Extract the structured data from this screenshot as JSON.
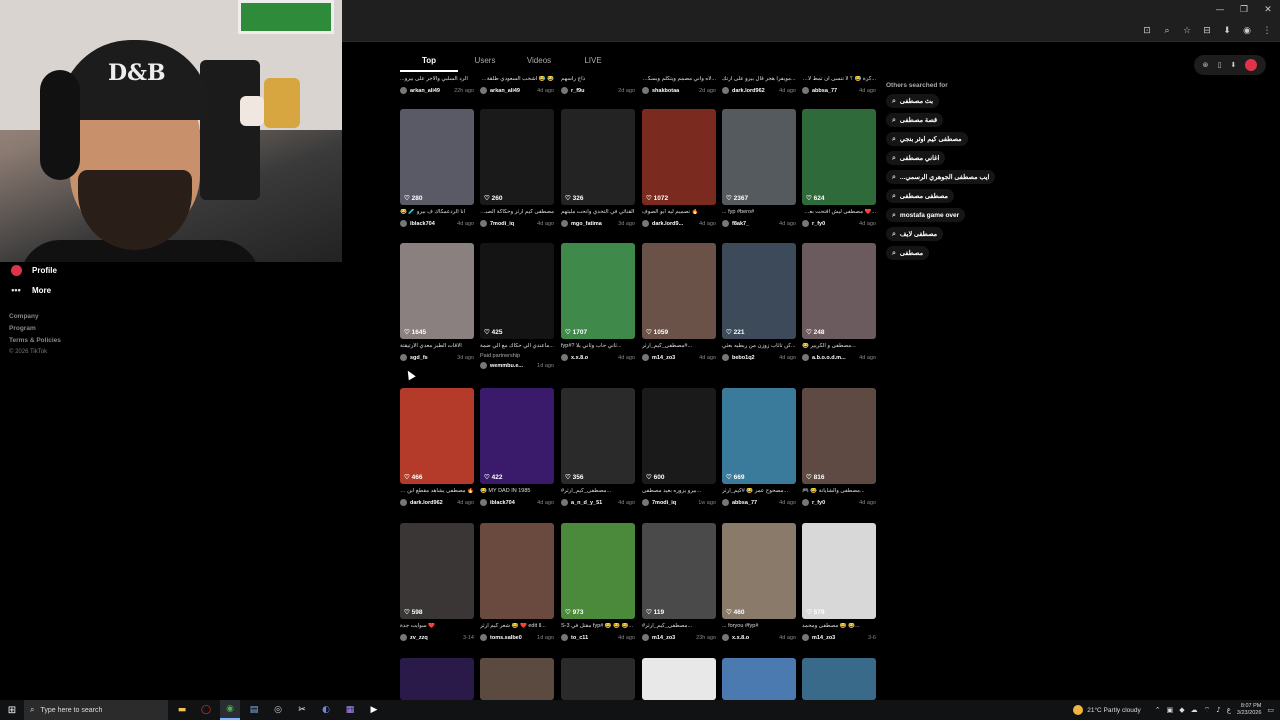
{
  "browser": {
    "window_controls": [
      "—",
      "❐",
      "✕"
    ],
    "address_icons": [
      "⊡",
      "⌕",
      "☆",
      "⊟",
      "⬇",
      "◉",
      "⋮"
    ]
  },
  "sidebar": {
    "items": [
      {
        "label": "Profile",
        "icon": "profile-icon"
      },
      {
        "label": "More",
        "icon": "more-icon"
      }
    ],
    "footer": {
      "company": "Company",
      "program": "Program",
      "terms": "Terms & Policies",
      "copyright": "© 2026 TikTok"
    }
  },
  "tabs": [
    {
      "label": "Top",
      "active": true
    },
    {
      "label": "Users",
      "active": false
    },
    {
      "label": "Videos",
      "active": false
    },
    {
      "label": "LIVE",
      "active": false
    }
  ],
  "top_row": [
    {
      "caption": "الرد السلبي والاجر على بيرو...",
      "user": "arkan_ali49",
      "date": "22h ago"
    },
    {
      "caption": "😂 😂 اشحب السعودي طلقة_مثل...",
      "user": "arkan_ali49",
      "date": "4d ago"
    },
    {
      "caption": "ذاج راسهم",
      "user": "r_f9u",
      "date": "2d ago"
    },
    {
      "caption": "...لاه واني مصمم ويتكلم وبسكتوا",
      "user": "shakbotaa",
      "date": "2d ago"
    },
    {
      "caption": "...مويفرا هجر قال بيرو على ارتك",
      "user": "dark.lord962",
      "date": "4d ago"
    },
    {
      "caption": "...كرة 😂 ؟ لا تنسى ان تمط لايك",
      "user": "abbsa_77",
      "date": "4d ago"
    }
  ],
  "rows": [
    [
      {
        "likes": "280",
        "caption": "انا الردعمكاك ف بيرو 🧪 😂",
        "user": "iblack704",
        "date": "4d ago",
        "color": "#5a5a66"
      },
      {
        "likes": "260",
        "caption": "مصطفى كيم ارثر وحكاكة الصبان",
        "user": "7modi_iq",
        "date": "4d ago",
        "color": "#1a1a1a"
      },
      {
        "likes": "326",
        "caption": "القنائي في التحدي وانحت مليتهم",
        "user": "mgo_fatima",
        "date": "3d ago",
        "color": "#232323"
      },
      {
        "likes": "1072",
        "caption": "🔥 تصميم ليه ابو الصوف",
        "user": "dark.lord9...",
        "date": "4d ago",
        "color": "#7a2a1e"
      },
      {
        "likes": "2367",
        "caption": "#fyp #bero ...",
        "user": "f8ak7_",
        "date": "4d ago",
        "color": "#555a5e"
      },
      {
        "likes": "624",
        "caption": "...❤️ مصطفى ليش اقتحت بعمرة",
        "user": "r_fy0",
        "date": "4d ago",
        "color": "#2e6a3a"
      }
    ],
    [
      {
        "likes": "1645",
        "caption": "الاقات الطبز معدي الارتيقتة",
        "user": "sgd_fs",
        "date": "3d ago",
        "color": "#8a8080"
      },
      {
        "likes": "425",
        "caption": "...ماعندي الي حكاك مع الي ضمة",
        "user": "wemmbu.e...",
        "date": "1d ago",
        "color": "#141414",
        "paid": "Paid partnership"
      },
      {
        "likes": "1707",
        "caption": "...ثاني حاب وثاني يلا ?#fyp",
        "user": "x.x.8.o",
        "date": "4d ago",
        "color": "#3f8a4a"
      },
      {
        "likes": "1059",
        "caption": "...#مصطفى_كيم_ارثر",
        "user": "m14_zo3",
        "date": "4d ago",
        "color": "#6a5248"
      },
      {
        "likes": "221",
        "caption": "...كن تاثاب زوزن من ربطيه بعثي",
        "user": "bebo1q2",
        "date": "4d ago",
        "color": "#3c4a5a"
      },
      {
        "likes": "248",
        "caption": "...مصطفى و الكريير 😂",
        "user": "a.b.o.o.d.m...",
        "date": "4d ago",
        "color": "#6b5a5e"
      }
    ],
    [
      {
        "likes": "466",
        "caption": "🔥 مصطفى يشاهد مقطع ابن دبطة",
        "user": "dark.lord962",
        "date": "4d ago",
        "color": "#b43a2a"
      },
      {
        "likes": "422",
        "caption": "MY DAD IN 1985 😂",
        "user": "iblack704",
        "date": "4d ago",
        "color": "#3a1a6a"
      },
      {
        "likes": "356",
        "caption": "...مصطفى_كيم_ارثر#",
        "user": "a_n_d_y_51",
        "date": "4d ago",
        "color": "#2a2a2a"
      },
      {
        "likes": "600",
        "caption": "...بيرو يزوره بعيد مصطفى",
        "user": "7modi_iq",
        "date": "1w ago",
        "color": "#1a1a1a"
      },
      {
        "likes": "669",
        "caption": "...مصحوح عمر 😂 #كيم_ارثر",
        "user": "abbsa_77",
        "date": "4d ago",
        "color": "#3a7a9a"
      },
      {
        "likes": "816",
        "caption": "...مصطفى والشاياتة 😂 🎮",
        "user": "r_fy0",
        "date": "4d ago",
        "color": "#5e4a42"
      }
    ],
    [
      {
        "likes": "598",
        "caption": "❤️ سوايت جدة",
        "user": "zv_zzq",
        "date": "3-14",
        "color": "#3a3636"
      },
      {
        "likes": "",
        "caption": "...edit ll ❤️ 😂 شعر كيم ارثر",
        "user": "toms.salbe0",
        "date": "1d ago",
        "color": "#6a4a3e"
      },
      {
        "likes": "973",
        "caption": "...😂 😂 😂 #fyp مقتل في S-3",
        "user": "to_c11",
        "date": "4d ago",
        "color": "#4a8a3a"
      },
      {
        "likes": "119",
        "caption": "...مصطفى_كيم_ارثر#",
        "user": "m14_zo3",
        "date": "23h ago",
        "color": "#4a4a4a"
      },
      {
        "likes": "460",
        "caption": "#foryou #fyp ...",
        "user": "x.x.8.o",
        "date": "4d ago",
        "color": "#8a7a6a"
      },
      {
        "likes": "579",
        "caption": "...😂 😂 مصطفى ومحمد",
        "user": "m14_zo3",
        "date": "3-6",
        "color": "#d8d8d8"
      }
    ]
  ],
  "bottom_partial": [
    "#2a1a4a",
    "#5a4a40",
    "#2a2a2a",
    "#e8e8e8",
    "#4a7ab0",
    "#3a6a8a"
  ],
  "others": {
    "title": "Others searched for",
    "items": [
      "بث مصطفى",
      "قصة مصطفى",
      "مصطفى كيم اوثر بنجي",
      "اغاني مصطفى",
      "...ايب مصطفى الجوهري الرسمي",
      "مصطفى مصطفى",
      "mostafa game over",
      "مصطفى لايف",
      "مصطفى"
    ]
  },
  "taskbar": {
    "search_placeholder": "Type here to search",
    "weather": "21°C  Partly cloudy",
    "time": "8:07 PM",
    "date": "3/23/2026"
  }
}
